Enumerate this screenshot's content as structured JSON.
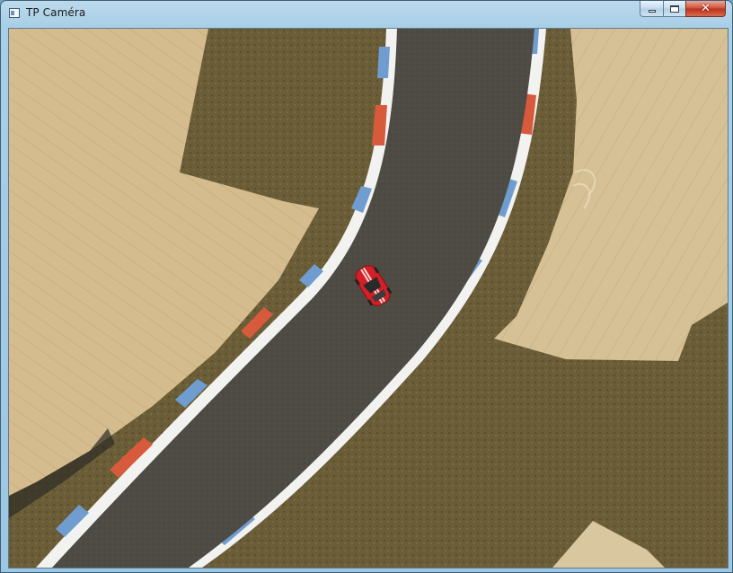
{
  "window": {
    "title": "TP Caméra",
    "icon": "app-window-icon",
    "controls": {
      "minimize_icon": "minimize-icon",
      "maximize_icon": "maximize-icon",
      "close_icon": "close-icon",
      "close_glyph": "✕"
    }
  },
  "scene": {
    "colors": {
      "sand": "#d4bc8e",
      "grass": "#6e5f39",
      "asphalt": "#4e4b44",
      "kerb_white": "#f2f2f0",
      "kerb_red": "#d85a3c",
      "kerb_blue": "#6f9dcf",
      "car_body": "#d31f26"
    },
    "car": {
      "color": "red",
      "icon": "race-car-icon"
    }
  }
}
